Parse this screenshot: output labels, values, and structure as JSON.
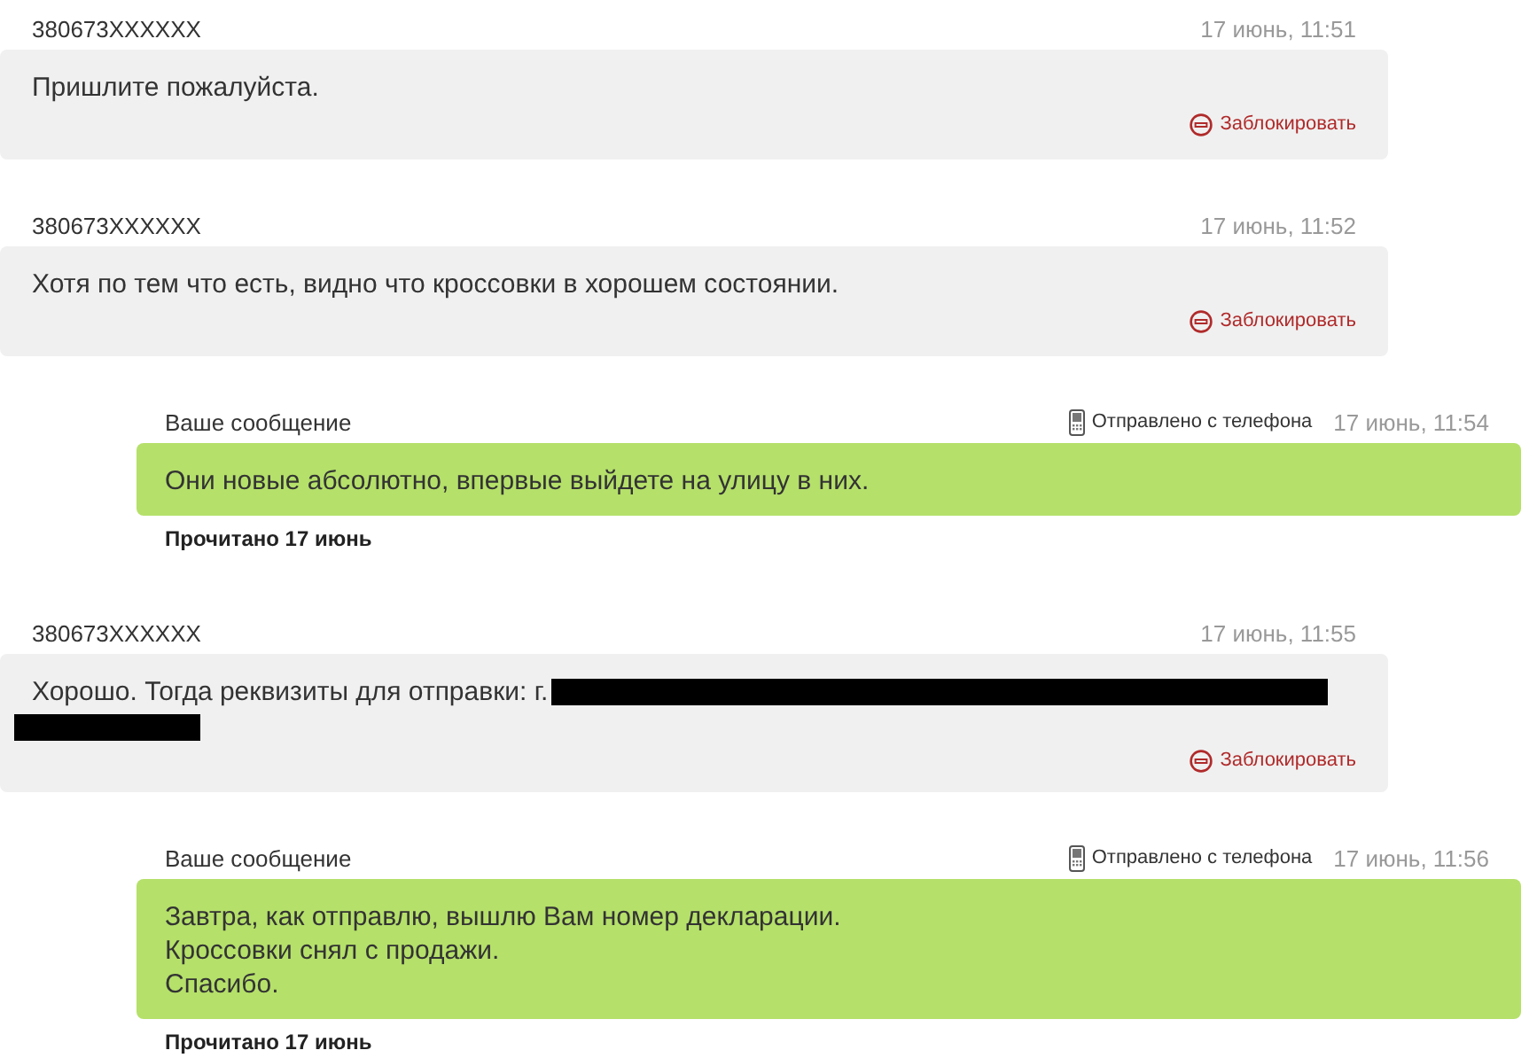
{
  "messages": [
    {
      "kind": "incoming",
      "sender": "380673XXXXXX",
      "time": "17 июнь, 11:51",
      "lines": [
        "Пришлите пожалуйста."
      ],
      "redacted": false,
      "action": "Заблокировать"
    },
    {
      "kind": "incoming",
      "sender": "380673XXXXXX",
      "time": "17 июнь, 11:52",
      "lines": [
        "Хотя по тем что есть, видно что кроссовки в хорошем состоянии."
      ],
      "redacted": false,
      "action": "Заблокировать"
    },
    {
      "kind": "outgoing",
      "sender": "Ваше сообщение",
      "source": "Отправлено с телефона",
      "time": "17 июнь, 11:54",
      "lines": [
        "Они новые абсолютно, впервые выйдете на улицу в них."
      ],
      "status": "Прочитано 17 июнь"
    },
    {
      "kind": "incoming",
      "sender": "380673XXXXXX",
      "time": "17 июнь, 11:55",
      "lines": [
        "Хорошо. Тогда реквизиты для отправки: г."
      ],
      "redacted": true,
      "action": "Заблокировать"
    },
    {
      "kind": "outgoing",
      "sender": "Ваше сообщение",
      "source": "Отправлено с телефона",
      "time": "17 июнь, 11:56",
      "lines": [
        "Завтра, как отправлю, вышлю Вам номер декларации.",
        "Кроссовки снял с продажи.",
        "Спасибо."
      ],
      "status": "Прочитано 17 июнь"
    }
  ]
}
